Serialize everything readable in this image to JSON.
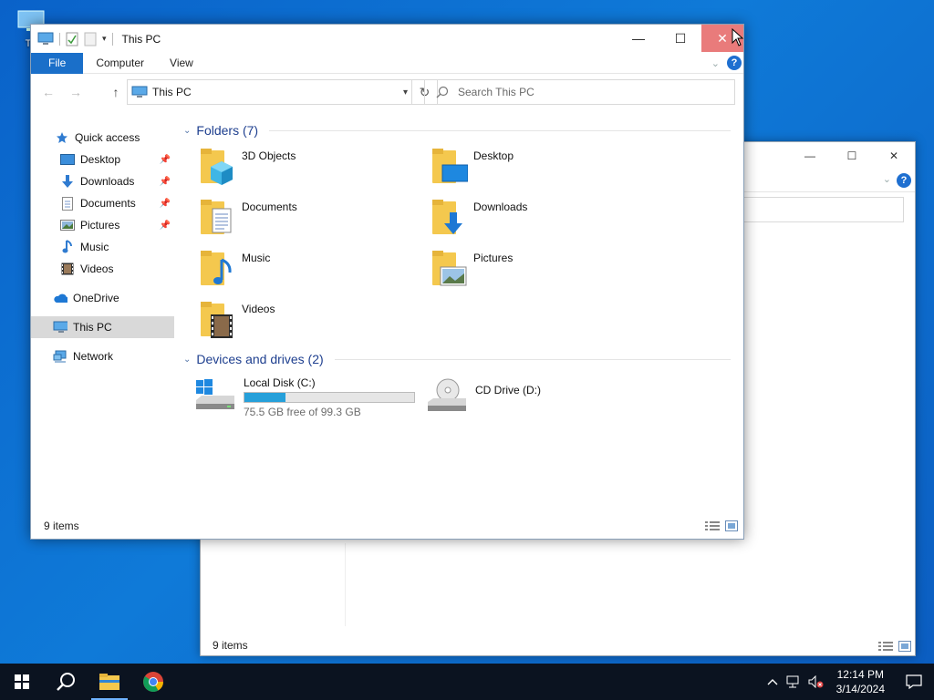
{
  "desktop": {
    "icon_label": "Th"
  },
  "window": {
    "title": "This PC",
    "ribbon_tabs": [
      "File",
      "Computer",
      "View"
    ],
    "address": {
      "path": "This PC"
    },
    "search": {
      "placeholder": "Search This PC"
    },
    "sidebar": {
      "quick_access": "Quick access",
      "pinned": [
        "Desktop",
        "Downloads",
        "Documents",
        "Pictures"
      ],
      "unpinned": [
        "Music",
        "Videos"
      ],
      "onedrive": "OneDrive",
      "this_pc": "This PC",
      "network": "Network"
    },
    "folders_header": "Folders (7)",
    "folders": [
      "3D Objects",
      "Desktop",
      "Documents",
      "Downloads",
      "Music",
      "Pictures",
      "Videos"
    ],
    "drives_header": "Devices and drives (2)",
    "drives": [
      {
        "name": "Local Disk (C:)",
        "free_text": "75.5 GB free of 99.3 GB",
        "used_fraction": 0.24
      },
      {
        "name": "CD Drive (D:)"
      }
    ],
    "status": "9 items"
  },
  "background_window": {
    "status": "9 items"
  },
  "taskbar": {
    "time": "12:14 PM",
    "date": "3/14/2024"
  },
  "colors": {
    "accent": "#1a6fc9",
    "close_hover": "#e97b7b",
    "capacity": "#26a0da",
    "taskbar": "#0b1320"
  }
}
